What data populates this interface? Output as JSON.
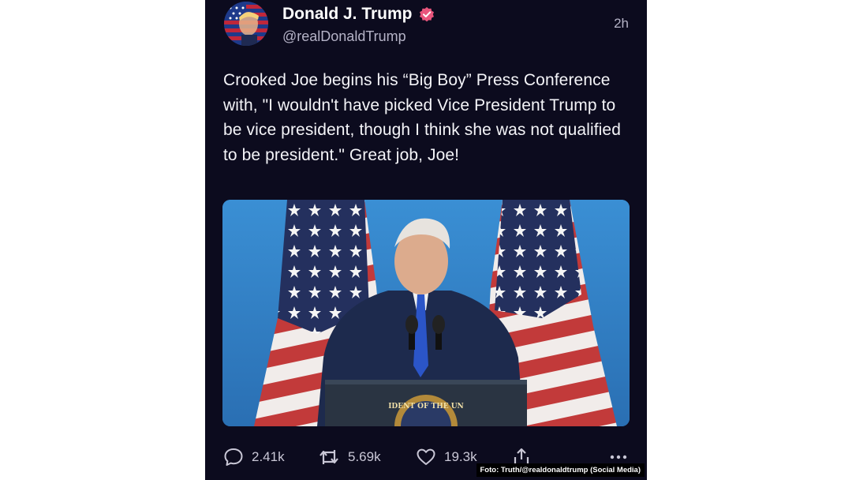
{
  "author": {
    "display_name": "Donald J. Trump",
    "handle": "@realDonaldTrump",
    "verified": true,
    "avatar_icon": "flag-portrait-avatar"
  },
  "post": {
    "timestamp": "2h",
    "text": "Crooked Joe begins his “Big Boy” Press Conference with, \"I wouldn't have picked Vice President Trump to be vice president, though I think she was not qualified to be president.\" Great job, Joe!",
    "media_icon": "press-conference-photo",
    "seal_text": "IDENT OF THE UN"
  },
  "actions": {
    "replies": "2.41k",
    "retruths": "5.69k",
    "likes": "19.3k",
    "share_icon": "share-icon",
    "more_icon": "more-dots-icon"
  },
  "caption": "Foto: Truth/@realdonaldtrump (Social Media)",
  "colors": {
    "background": "#0c0b1e",
    "verified_badge": "#e8557c",
    "text_secondary": "#b5b3c7"
  }
}
